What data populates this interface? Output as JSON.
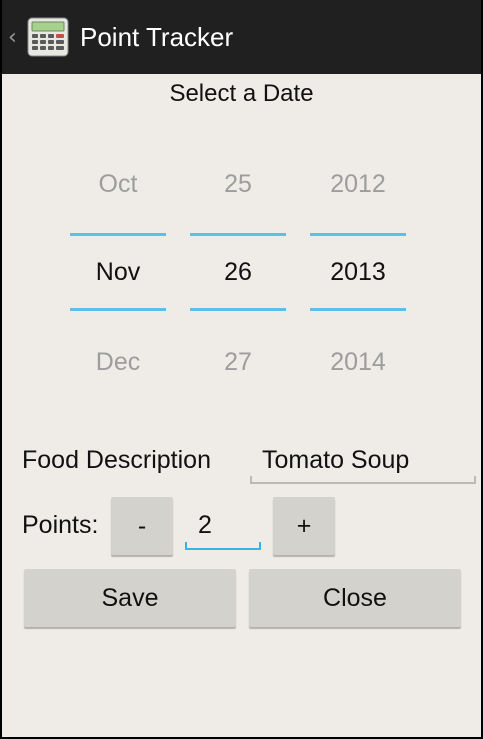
{
  "actionbar": {
    "title": "Point Tracker",
    "up_icon": "chevron-left-icon",
    "app_icon": "calculator-icon"
  },
  "date_picker": {
    "heading": "Select a Date",
    "month": {
      "prev": "Oct",
      "current": "Nov",
      "next": "Dec"
    },
    "day": {
      "prev": "25",
      "current": "26",
      "next": "27"
    },
    "year": {
      "prev": "2012",
      "current": "2013",
      "next": "2014"
    }
  },
  "food": {
    "label": "Food Description",
    "value": "Tomato Soup"
  },
  "points": {
    "label": "Points:",
    "minus_label": "-",
    "value": "2",
    "plus_label": "+"
  },
  "actions": {
    "save_label": "Save",
    "close_label": "Close"
  },
  "colors": {
    "actionbar": "#202020",
    "background": "#efece7",
    "accent": "#33b5e5",
    "button": "#d4d2cd"
  }
}
